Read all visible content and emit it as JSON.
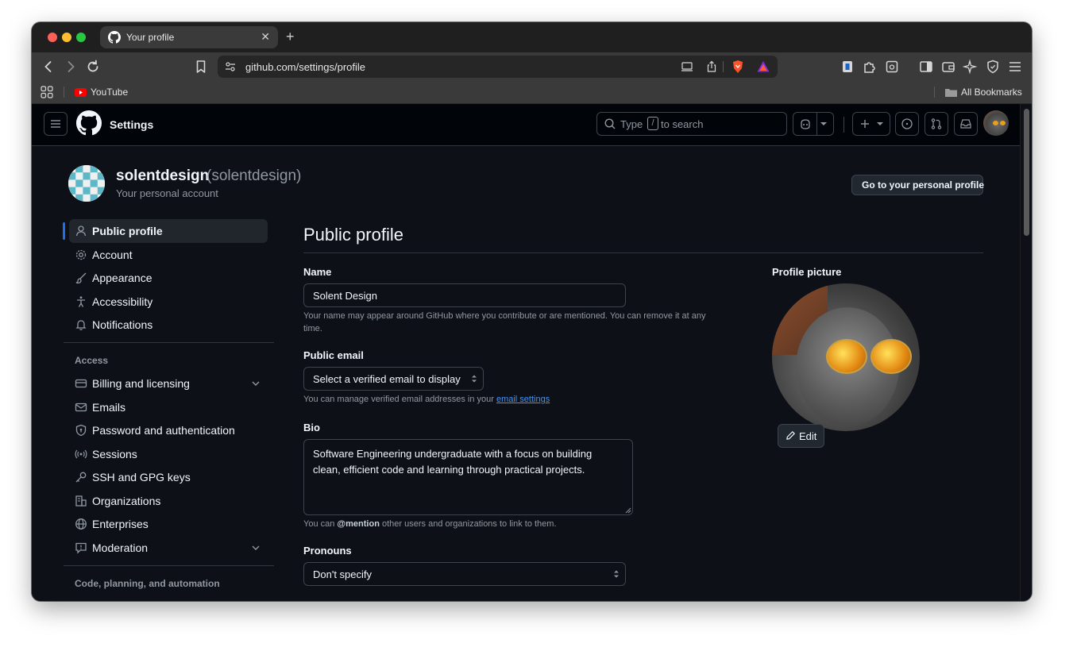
{
  "browser": {
    "tab_title": "Your profile",
    "url": "github.com/settings/profile",
    "bookmarks": {
      "youtube": "YouTube",
      "all_bookmarks": "All Bookmarks"
    }
  },
  "header": {
    "title": "Settings",
    "search_prefix": "Type",
    "search_key": "/",
    "search_suffix": "to search"
  },
  "account": {
    "username": "solentdesign",
    "handle": "(solentdesign)",
    "subtitle": "Your personal account",
    "go_to_profile": "Go to your personal profile"
  },
  "sidebar": {
    "items": [
      {
        "label": "Public profile",
        "icon": "person-icon"
      },
      {
        "label": "Account",
        "icon": "gear-icon"
      },
      {
        "label": "Appearance",
        "icon": "paintbrush-icon"
      },
      {
        "label": "Accessibility",
        "icon": "accessibility-icon"
      },
      {
        "label": "Notifications",
        "icon": "bell-icon"
      }
    ],
    "access_heading": "Access",
    "access_items": [
      {
        "label": "Billing and licensing",
        "icon": "credit-card-icon"
      },
      {
        "label": "Emails",
        "icon": "mail-icon"
      },
      {
        "label": "Password and authentication",
        "icon": "shield-lock-icon"
      },
      {
        "label": "Sessions",
        "icon": "broadcast-icon"
      },
      {
        "label": "SSH and GPG keys",
        "icon": "key-icon"
      },
      {
        "label": "Organizations",
        "icon": "organization-icon"
      },
      {
        "label": "Enterprises",
        "icon": "globe-icon"
      },
      {
        "label": "Moderation",
        "icon": "report-icon"
      }
    ],
    "code_heading": "Code, planning, and automation"
  },
  "main": {
    "heading": "Public profile",
    "name_label": "Name",
    "name_value": "Solent Design",
    "name_help_1": "Your name may appear around GitHub where you contribute or are mentioned. You can remove it at any",
    "name_help_2": "time.",
    "email_label": "Public email",
    "email_select": "Select a verified email to display",
    "email_help": "You can manage verified email addresses in your",
    "email_help_link": "email settings",
    "bio_label": "Bio",
    "bio_line_1": "Software Engineering undergraduate with a focus on building",
    "bio_line_2": "clean, efficient code and learning through practical projects.",
    "bio_help_1": "You can",
    "bio_help_mention": "@mention",
    "bio_help_2": "other users and organizations to link to them.",
    "pronouns_label": "Pronouns",
    "pronouns_value": "Don't specify",
    "picture_label": "Profile picture",
    "edit_label": "Edit"
  },
  "colors": {
    "page_bg": "#0d1117",
    "header_bg": "#010409",
    "accent": "#4493f8",
    "active_indicator": "#1f6feb"
  }
}
